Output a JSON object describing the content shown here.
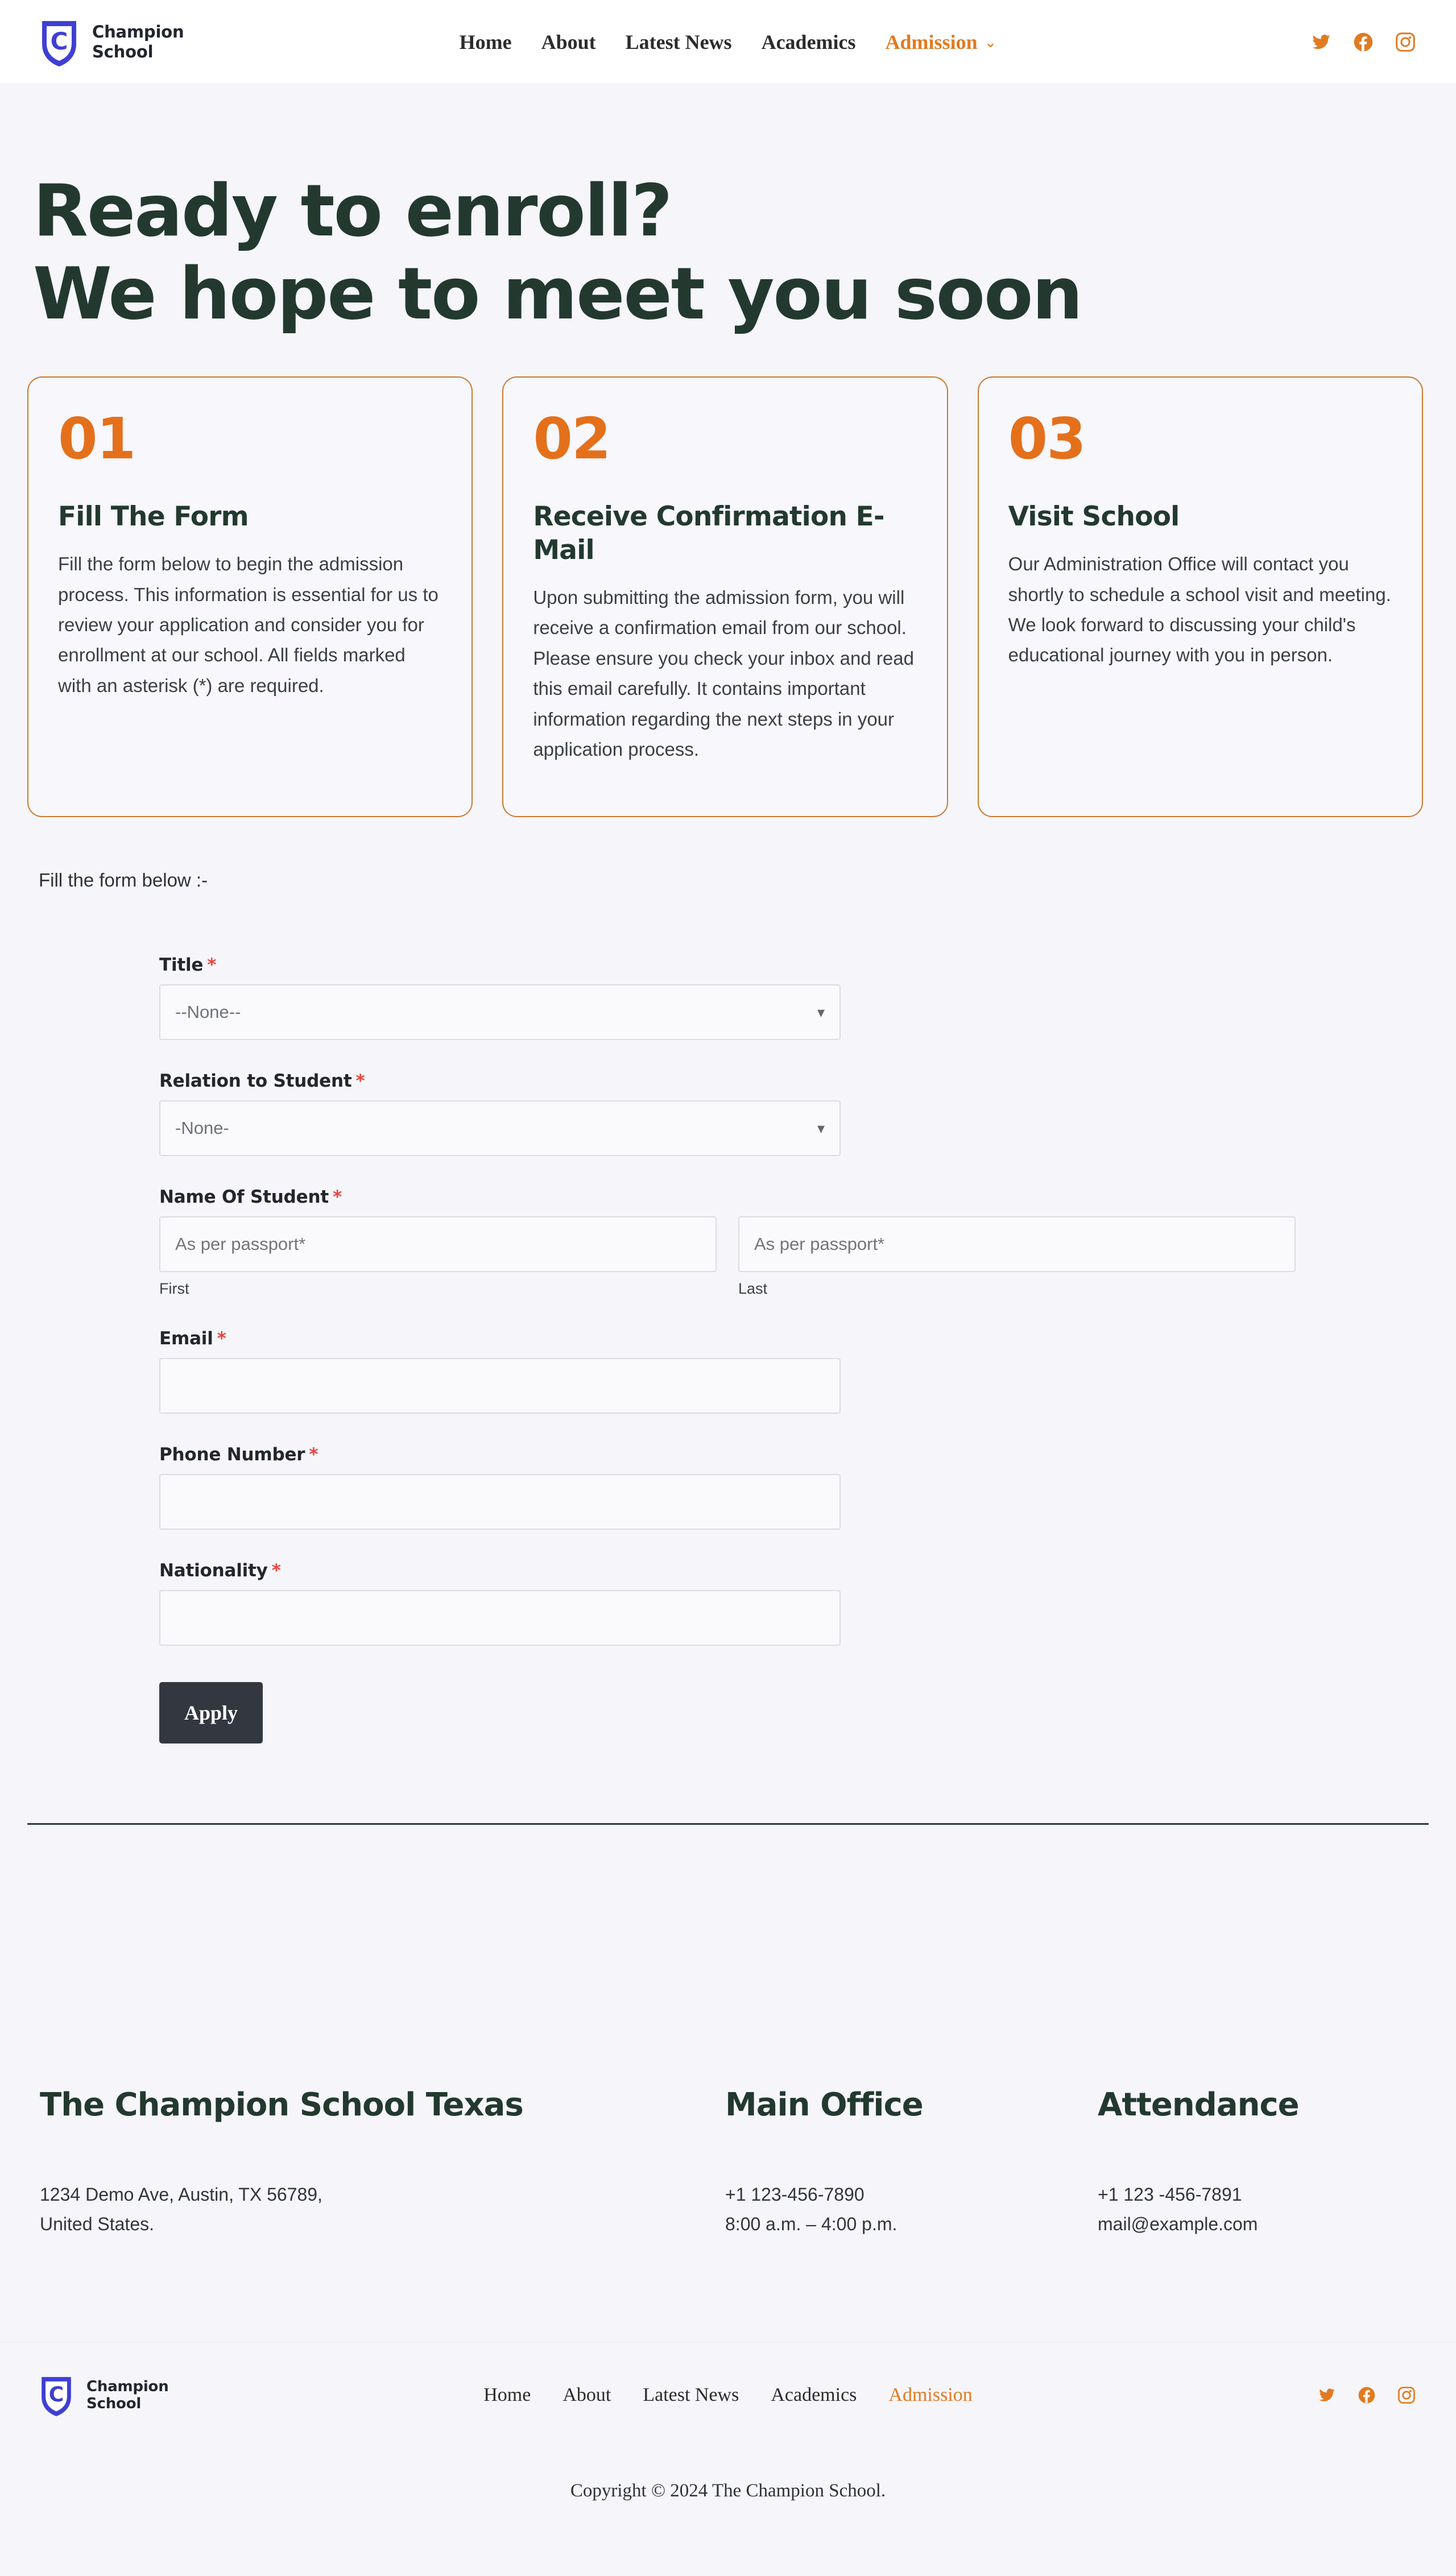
{
  "brand": {
    "line1": "Champion",
    "line2": "School",
    "logo_icon": "shield-c-logo",
    "accent_blue": "#3f3fd4"
  },
  "header": {
    "nav": [
      {
        "label": "Home",
        "active": false
      },
      {
        "label": "About",
        "active": false
      },
      {
        "label": "Latest News",
        "active": false
      },
      {
        "label": "Academics",
        "active": false
      },
      {
        "label": "Admission",
        "active": true,
        "caret": "⌄"
      }
    ],
    "social": [
      {
        "name": "twitter-icon",
        "label": "Twitter"
      },
      {
        "name": "facebook-icon",
        "label": "Facebook"
      },
      {
        "name": "instagram-icon",
        "label": "Instagram"
      }
    ]
  },
  "hero": {
    "line1": "Ready to enroll?",
    "line2": "We hope to meet you soon"
  },
  "steps": [
    {
      "number": "01",
      "title": "Fill The Form",
      "body": "Fill the form below to begin the admission process. This information is essential for us to review your application and consider you for enrollment at our school. All fields marked with an asterisk (*) are required."
    },
    {
      "number": "02",
      "title": "Receive Confirmation E-Mail",
      "body": "Upon submitting the admission form, you will receive a confirmation email from our school. Please ensure you check your inbox and read this email carefully. It contains important information regarding the next steps in your application process."
    },
    {
      "number": "03",
      "title": "Visit School",
      "body": "Our Administration Office will contact you shortly to schedule a school visit and meeting. We look forward to discussing your child's educational journey with you in person."
    }
  ],
  "form": {
    "intro": "Fill the form below :-",
    "required_marker": "*",
    "title_field": {
      "label": "Title",
      "value": "--None--",
      "options": [
        "--None--"
      ]
    },
    "relation_field": {
      "label": "Relation to Student",
      "value": "-None-",
      "options": [
        "-None-"
      ]
    },
    "name_field": {
      "label": "Name Of Student",
      "first": {
        "placeholder": "As per passport*",
        "value": "",
        "sub_label": "First"
      },
      "last": {
        "placeholder": "As per passport*",
        "value": "",
        "sub_label": "Last"
      }
    },
    "email_field": {
      "label": "Email",
      "value": "",
      "placeholder": ""
    },
    "phone_field": {
      "label": "Phone Number",
      "value": "",
      "placeholder": ""
    },
    "nationality_field": {
      "label": "Nationality",
      "value": "",
      "placeholder": ""
    },
    "submit_label": "Apply"
  },
  "footer_info": [
    {
      "heading": "The Champion School Texas",
      "line1": "1234 Demo Ave, Austin, TX 56789,",
      "line2": "United States."
    },
    {
      "heading": "Main Office",
      "line1": "+1 123-456-7890",
      "line2": "8:00 a.m. – 4:00 p.m."
    },
    {
      "heading": "Attendance",
      "line1": "+1 123 -456-7891",
      "line2": "mail@example.com"
    }
  ],
  "footer_bar": {
    "nav": [
      {
        "label": "Home",
        "active": false
      },
      {
        "label": "About",
        "active": false
      },
      {
        "label": "Latest News",
        "active": false
      },
      {
        "label": "Academics",
        "active": false
      },
      {
        "label": "Admission",
        "active": true
      }
    ],
    "copyright": "Copyright © 2024 The Champion School."
  },
  "colors": {
    "accent_orange": "#e4701b",
    "nav_orange": "#e07b22",
    "heading_green": "#23392f",
    "card_border": "#c87a2e",
    "page_bg": "#f5f5fa",
    "required_red": "#e8463f"
  }
}
